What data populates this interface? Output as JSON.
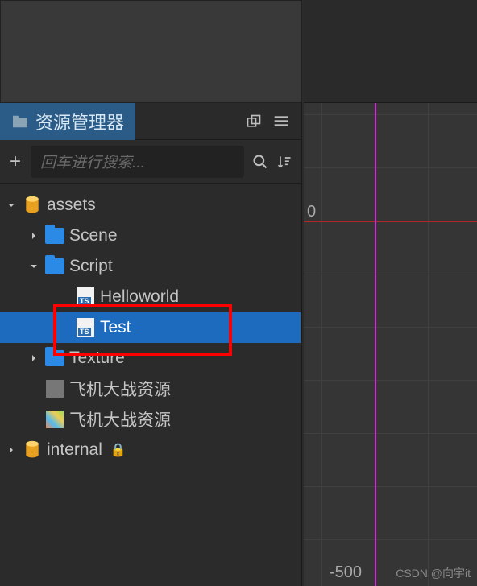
{
  "panel": {
    "title": "资源管理器",
    "search_placeholder": "回车进行搜索..."
  },
  "tree": {
    "root": {
      "name": "assets",
      "children": [
        {
          "name": "Scene"
        },
        {
          "name": "Script",
          "children": [
            {
              "name": "Helloworld"
            },
            {
              "name": "Test",
              "selected": true
            }
          ]
        },
        {
          "name": "Texture"
        },
        {
          "name": "飞机大战资源",
          "icon": "gray"
        },
        {
          "name": "飞机大战资源",
          "icon": "atlas"
        }
      ]
    },
    "internal": {
      "name": "internal",
      "locked": true
    }
  },
  "scene": {
    "origin_label": "0",
    "lower_tick": "-500"
  },
  "watermark": "CSDN @向宇it"
}
